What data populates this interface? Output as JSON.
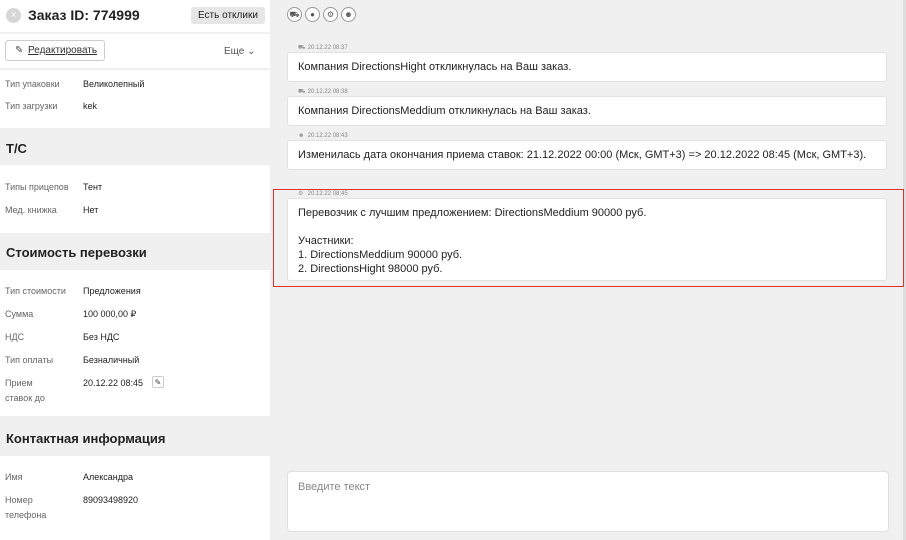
{
  "header": {
    "close_glyph": "×",
    "title": "Заказ ID: 774999",
    "responses_button": "Есть отклики"
  },
  "toolbar": {
    "edit_label": "Редактировать",
    "more_label": "Еще ⌄"
  },
  "details": [
    {
      "key": "Тип упаковки",
      "value": "Великолепный"
    },
    {
      "key": "Тип загрузки",
      "value": "kek"
    }
  ],
  "transport": {
    "title": "Т/С",
    "rows": [
      {
        "key": "Типы прицепов",
        "value": "Тент"
      },
      {
        "key": "Мед. книжка",
        "value": "Нет"
      }
    ]
  },
  "cost": {
    "title": "Стоимость перевозки",
    "rows": [
      {
        "key": "Тип стоимости",
        "value": "Предложения"
      },
      {
        "key": "Сумма",
        "value": "100 000,00 ₽"
      },
      {
        "key": "НДС",
        "value": "Без НДС"
      },
      {
        "key": "Тип оплаты",
        "value": "Безналичный"
      },
      {
        "key": "Прием ставок до",
        "value": "20.12.22 08:45"
      }
    ]
  },
  "contact": {
    "title": "Контактная информация",
    "rows": [
      {
        "key": "Имя",
        "value": "Александра"
      },
      {
        "key": "Номер телефона",
        "value": "89093498920"
      }
    ]
  },
  "filter_icons": [
    "truck-icon",
    "user-icon",
    "gear-icon",
    "users-icon"
  ],
  "messages": [
    {
      "icon": "truck-icon",
      "time": "20.12.22 08:37",
      "text": "Компания DirectionsHight откликнулась на Ваш заказ."
    },
    {
      "icon": "truck-icon",
      "time": "20.12.22 08:38",
      "text": "Компания DirectionsMeddium откликнулась на Ваш заказ."
    },
    {
      "icon": "users-icon",
      "time": "20.12.22 08:43",
      "text": "Изменилась дата окончания приема ставок: 21.12.2022 00:00 (Мск, GMT+3) => 20.12.2022 08:45 (Мск, GMT+3)."
    },
    {
      "icon": "gear-icon",
      "time": "20.12.22 08:45",
      "line1": "Перевозчик с лучшим предложением: DirectionsMeddium 90000 руб.",
      "line2": "Участники:",
      "line3": "1. DirectionsMeddium 90000 руб.",
      "line4": "2. DirectionsHight 98000 руб."
    }
  ],
  "input": {
    "placeholder": "Введите текст"
  }
}
